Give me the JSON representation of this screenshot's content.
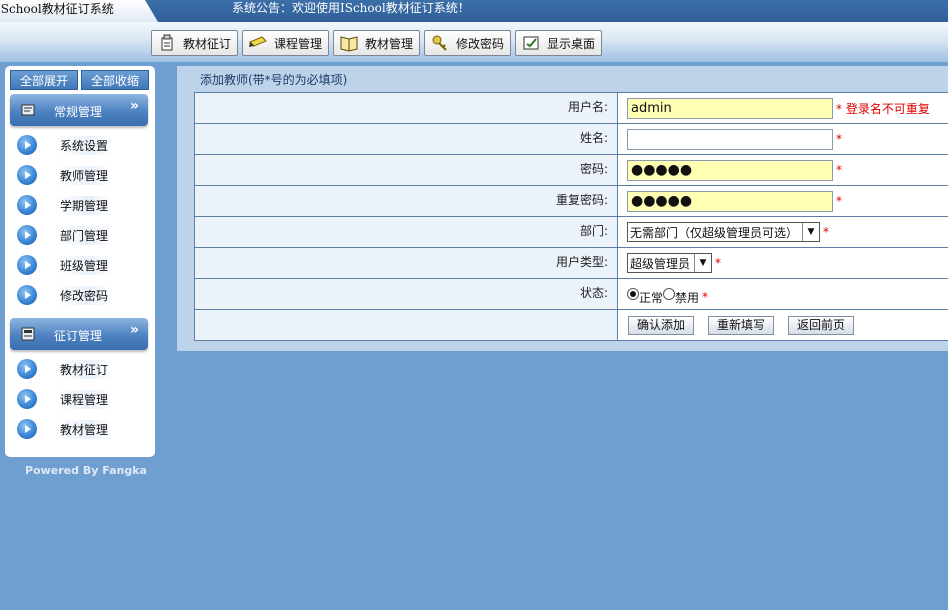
{
  "header": {
    "app_title": "ISchool教材征订系统",
    "announcement": "系统公告：欢迎使用ISchool教材征订系统！"
  },
  "nav": {
    "buttons": [
      {
        "label": "教材征订",
        "icon": "textbook-order-icon"
      },
      {
        "label": "课程管理",
        "icon": "pencil-icon"
      },
      {
        "label": "教材管理",
        "icon": "book-icon"
      },
      {
        "label": "修改密码",
        "icon": "key-icon"
      },
      {
        "label": "显示桌面",
        "icon": "desktop-icon"
      }
    ]
  },
  "sidebar": {
    "expand_all": "全部展开",
    "collapse_all": "全部收缩",
    "groups": [
      {
        "title": "常规管理",
        "items": [
          "系统设置",
          "教师管理",
          "学期管理",
          "部门管理",
          "班级管理",
          "修改密码"
        ]
      },
      {
        "title": "征订管理",
        "items": [
          "教材征订",
          "课程管理",
          "教材管理"
        ]
      }
    ],
    "powered_by": "Powered By Fangka"
  },
  "form": {
    "title": "添加教师(带*号的为必填项)",
    "username": {
      "label": "用户名:",
      "value": "admin",
      "note": "* 登录名不可重复"
    },
    "name": {
      "label": "姓名:",
      "value": "",
      "required": "*"
    },
    "password": {
      "label": "密码:",
      "value": "●●●●●",
      "required": "*"
    },
    "password_repeat": {
      "label": "重复密码:",
      "value": "●●●●●",
      "required": "*"
    },
    "department": {
      "label": "部门:",
      "selected": "无需部门（仅超级管理员可选）",
      "required": "*"
    },
    "user_type": {
      "label": "用户类型:",
      "selected": "超级管理员",
      "required": "*"
    },
    "status": {
      "label": "状态:",
      "options": [
        "正常",
        "禁用"
      ],
      "selected": "正常",
      "required": "*"
    },
    "actions": {
      "confirm": "确认添加",
      "reset": "重新填写",
      "back": "返回前页"
    }
  },
  "colors": {
    "page_bg": "#6f9fd0",
    "topbar": "#2f5f98",
    "required_red": "#dd0000",
    "input_highlight": "#ffffb3"
  }
}
